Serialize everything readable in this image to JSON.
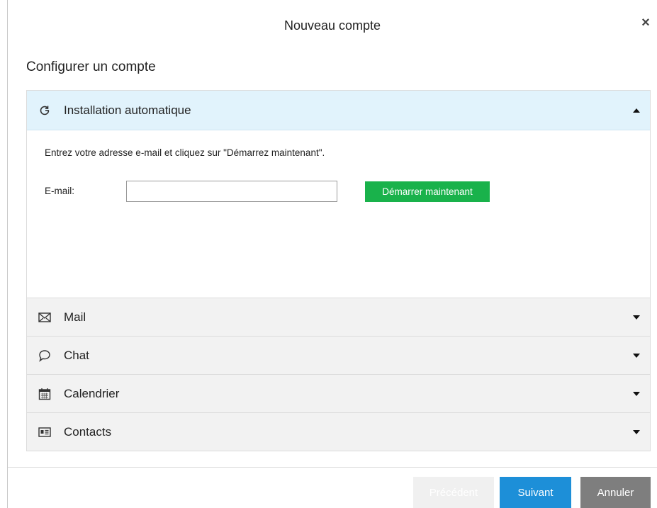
{
  "dialog": {
    "title": "Nouveau compte",
    "close_label": "×"
  },
  "heading": "Configurer un compte",
  "accordion": {
    "auto": {
      "label": "Installation automatique",
      "icon": "refresh-icon",
      "expanded": true,
      "instruction": "Entrez votre adresse e-mail et cliquez sur \"Démarrez maintenant\".",
      "email_label": "E-mail:",
      "email_value": "",
      "email_placeholder": "",
      "start_button": "Démarrer maintenant"
    },
    "items": [
      {
        "label": "Mail",
        "icon": "envelope-icon",
        "expanded": false
      },
      {
        "label": "Chat",
        "icon": "chat-bubble-icon",
        "expanded": false
      },
      {
        "label": "Calendrier",
        "icon": "calendar-icon",
        "expanded": false
      },
      {
        "label": "Contacts",
        "icon": "contact-card-icon",
        "expanded": false
      }
    ]
  },
  "footer": {
    "prev_label": "Précédent",
    "next_label": "Suivant",
    "cancel_label": "Annuler"
  },
  "colors": {
    "active_header": "#e1f3fc",
    "start_button": "#19b24b",
    "next_button": "#1d8fd8",
    "cancel_button": "#7e7e7e"
  }
}
